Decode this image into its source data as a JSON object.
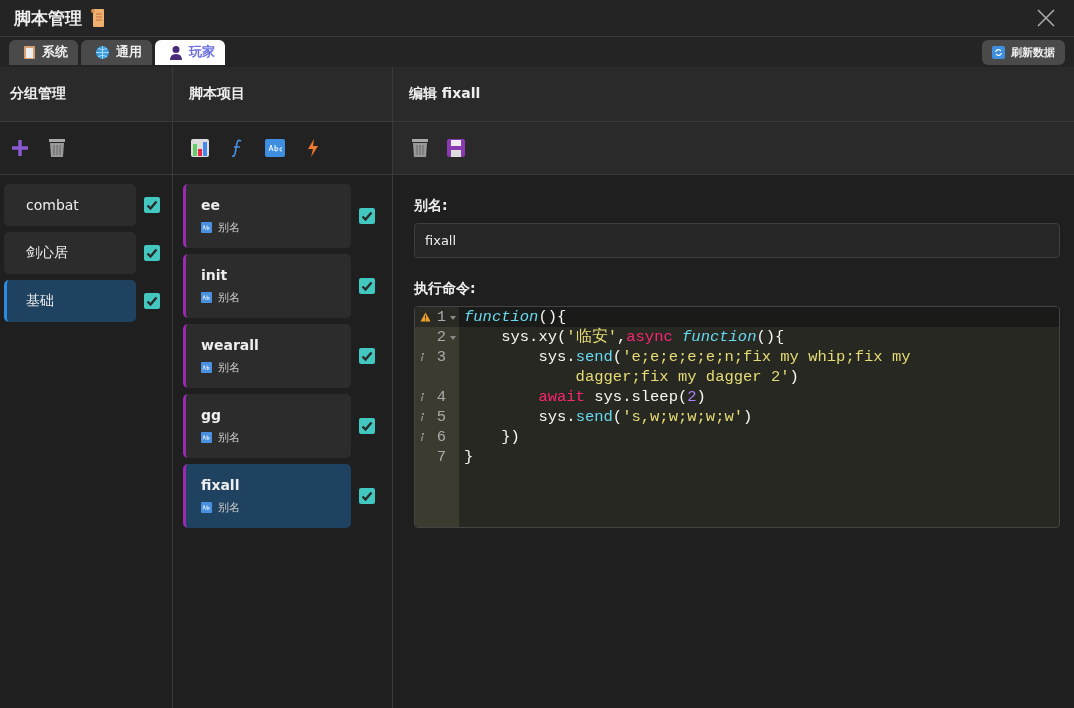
{
  "window": {
    "title": "脚本管理"
  },
  "tabs": [
    {
      "label": "系统",
      "selected": false
    },
    {
      "label": "通用",
      "selected": false
    },
    {
      "label": "玩家",
      "selected": true
    }
  ],
  "refresh_button": {
    "label": "刷新数据"
  },
  "groups_panel": {
    "title": "分组管理",
    "items": [
      {
        "name": "combat",
        "selected": false,
        "checked": true
      },
      {
        "name": "剑心居",
        "selected": false,
        "checked": true
      },
      {
        "name": "基础",
        "selected": true,
        "checked": true
      }
    ]
  },
  "scripts_panel": {
    "title": "脚本项目",
    "items": [
      {
        "name": "ee",
        "alias": "别名",
        "selected": false,
        "checked": true
      },
      {
        "name": "init",
        "alias": "别名",
        "selected": false,
        "checked": true
      },
      {
        "name": "wearall",
        "alias": "别名",
        "selected": false,
        "checked": true
      },
      {
        "name": "gg",
        "alias": "别名",
        "selected": false,
        "checked": true
      },
      {
        "name": "fixall",
        "alias": "别名",
        "selected": true,
        "checked": true
      }
    ]
  },
  "editor_panel": {
    "title": "编辑 fixall",
    "alias_label": "别名:",
    "alias_value": "fixall",
    "command_label": "执行命令:",
    "code_lines": [
      {
        "number": "1",
        "warning": true,
        "info": false,
        "foldable": true,
        "active": true,
        "tokens": [
          {
            "kind": "keyword",
            "text": "function"
          },
          {
            "kind": "plain",
            "text": "(){"
          }
        ]
      },
      {
        "number": "2",
        "warning": false,
        "info": false,
        "foldable": true,
        "active": false,
        "tokens": [
          {
            "kind": "plain",
            "text": "    sys.xy("
          },
          {
            "kind": "string",
            "text": "'临安'"
          },
          {
            "kind": "plain",
            "text": ","
          },
          {
            "kind": "control",
            "text": "async "
          },
          {
            "kind": "keyword",
            "text": "function"
          },
          {
            "kind": "plain",
            "text": "(){"
          }
        ]
      },
      {
        "number": "3",
        "warning": false,
        "info": true,
        "foldable": false,
        "active": false,
        "tokens": [
          {
            "kind": "plain",
            "text": "        sys."
          },
          {
            "kind": "method",
            "text": "send"
          },
          {
            "kind": "plain",
            "text": "("
          },
          {
            "kind": "string",
            "text": "'e;e;e;e;e;n;fix my whip;fix my"
          },
          {
            "kind": "break"
          },
          {
            "kind": "string",
            "text": "            dagger;fix my dagger 2'"
          },
          {
            "kind": "plain",
            "text": ")"
          }
        ]
      },
      {
        "number": "4",
        "warning": false,
        "info": true,
        "foldable": false,
        "active": false,
        "tokens": [
          {
            "kind": "control",
            "text": "        await"
          },
          {
            "kind": "plain",
            "text": " sys.sleep("
          },
          {
            "kind": "number",
            "text": "2"
          },
          {
            "kind": "plain",
            "text": ")"
          }
        ]
      },
      {
        "number": "5",
        "warning": false,
        "info": true,
        "foldable": false,
        "active": false,
        "tokens": [
          {
            "kind": "plain",
            "text": "        sys."
          },
          {
            "kind": "method",
            "text": "send"
          },
          {
            "kind": "plain",
            "text": "("
          },
          {
            "kind": "string",
            "text": "'s,w;w;w;w;w'"
          },
          {
            "kind": "plain",
            "text": ")"
          }
        ]
      },
      {
        "number": "6",
        "warning": false,
        "info": true,
        "foldable": false,
        "active": false,
        "tokens": [
          {
            "kind": "plain",
            "text": "    })"
          }
        ]
      },
      {
        "number": "7",
        "warning": false,
        "info": false,
        "foldable": false,
        "active": false,
        "tokens": [
          {
            "kind": "plain",
            "text": "}"
          }
        ]
      }
    ]
  }
}
